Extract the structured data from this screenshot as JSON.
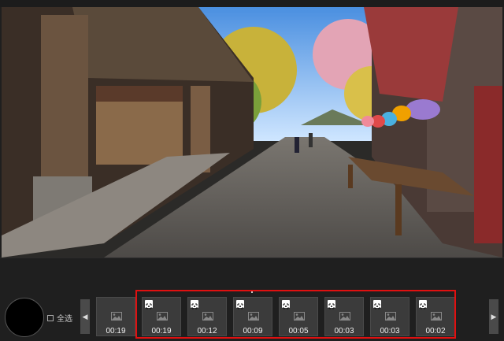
{
  "select_all": {
    "label": "全选"
  },
  "clips": [
    {
      "duration": "00:19",
      "panorama": false
    },
    {
      "duration": "00:19",
      "panorama": true
    },
    {
      "duration": "00:12",
      "panorama": true
    },
    {
      "duration": "00:09",
      "panorama": true
    },
    {
      "duration": "00:05",
      "panorama": true
    },
    {
      "duration": "00:03",
      "panorama": true
    },
    {
      "duration": "00:03",
      "panorama": true
    },
    {
      "duration": "00:02",
      "panorama": true
    }
  ],
  "colors": {
    "highlight": "#e01010",
    "background": "#1f1f1f",
    "thumb": "#3b3b3b"
  },
  "icons": {
    "left_nav": "chevron-left-icon",
    "right_nav": "chevron-right-icon"
  }
}
